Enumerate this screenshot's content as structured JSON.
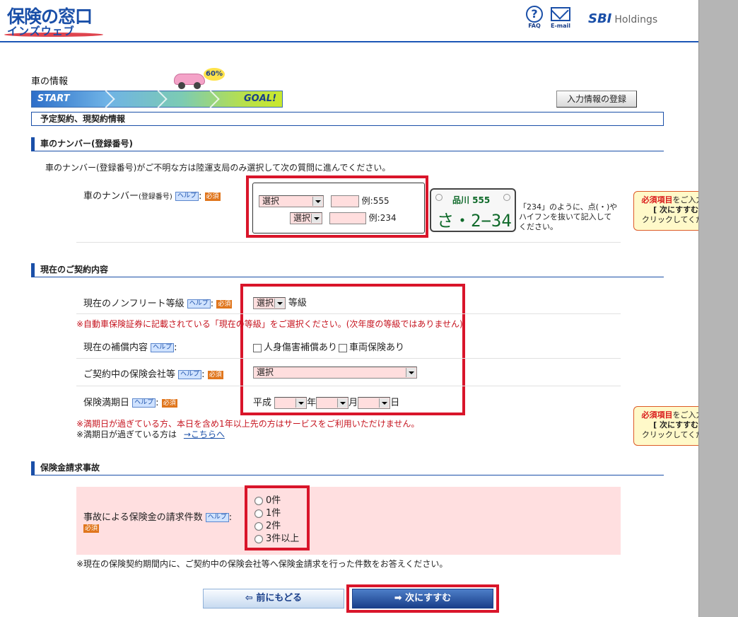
{
  "header": {
    "logo_line1": "保険の窓口",
    "logo_line2": "インズウェブ",
    "faq_label": "FAQ",
    "email_label": "E-mail",
    "sbi_brand": "SBI",
    "sbi_holdings": "Holdings"
  },
  "progress": {
    "section_title": "車の情報",
    "start_label": "START",
    "goal_label": "GOAL!",
    "percent": "60%",
    "register_button": "入力情報の登録"
  },
  "subheader": "予定契約、現契約情報",
  "group_plate": {
    "title": "車のナンバー(登録番号)",
    "instruction": "車のナンバー(登録番号)がご不明な方は陸運支局のみ選択して次の質問に進んでください。",
    "label_main": "車のナンバー",
    "label_small": "(登録番号)",
    "help": "ヘルプ",
    "req": "必須",
    "select1": "選択",
    "select2": "選択",
    "example1": "例:555",
    "example2": "例:234",
    "plate_top": "品川 555",
    "plate_bottom": "さ・2−34",
    "plate_note": "「234」のように、点(・)やハイフンを抜いて記入してください。"
  },
  "group_contract": {
    "title": "現在のご契約内容",
    "nonfleet_label": "現在のノンフリート等級",
    "nonfleet_select": "選択",
    "nonfleet_suffix": "等級",
    "nonfleet_note": "※自動車保険証券に記載されている「現在の等級」をご選択ください。(次年度の等級ではありません)",
    "coverage_label": "現在の補償内容",
    "coverage_opt1": "人身傷害補償あり",
    "coverage_opt2": "車両保険あり",
    "company_label": "ご契約中の保険会社等",
    "company_select": "選択",
    "expiry_label": "保険満期日",
    "expiry_era": "平成",
    "expiry_year": "年",
    "expiry_month": "月",
    "expiry_day": "日",
    "expiry_note1": "※満期日が過ぎている方、本日を含め1年以上先の方はサービスをご利用いただけません。",
    "expiry_note2": "※満期日が過ぎている方は",
    "expiry_link": "→こちらへ",
    "help": "ヘルプ",
    "req": "必須"
  },
  "group_claims": {
    "title": "保険金請求事故",
    "label": "事故による保険金の請求件数",
    "help": "ヘルプ",
    "req": "必須",
    "options": [
      "0件",
      "1件",
      "2件",
      "3件以上"
    ],
    "note": "※現在の保険契約期間内に、ご契約中の保険会社等へ保険金請求を行った件数をお答えください。"
  },
  "tip": {
    "red": "必須項目",
    "line1_rest": "をご入力の上、",
    "line2": "[ 次にすすむ ] を",
    "line3": "クリックしてください。"
  },
  "buttons": {
    "back": "前にもどる",
    "next": "次にすすむ"
  }
}
